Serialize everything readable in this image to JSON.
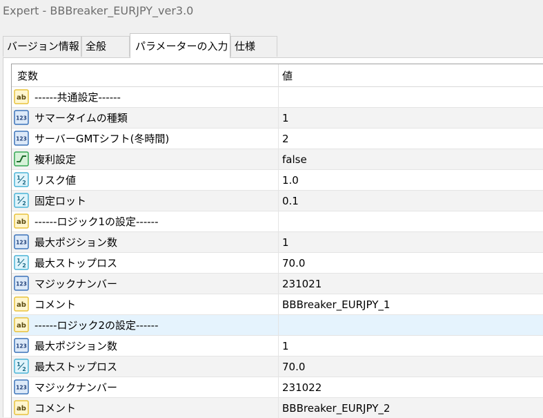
{
  "window": {
    "title": "Expert - BBBreaker_EURJPY_ver3.0"
  },
  "tabs": [
    {
      "label": "バージョン情報",
      "active": false
    },
    {
      "label": "全般",
      "active": false
    },
    {
      "label": "パラメーターの入力",
      "active": true
    },
    {
      "label": "仕様",
      "active": false
    }
  ],
  "table": {
    "headers": {
      "variable": "変数",
      "value": "値"
    },
    "rows": [
      {
        "type": "string",
        "icon": "ab-string-icon",
        "name": "------共通設定------",
        "value": ""
      },
      {
        "type": "int",
        "icon": "123-integer-icon",
        "name": "サマータイムの種類",
        "value": "1"
      },
      {
        "type": "int",
        "icon": "123-integer-icon",
        "name": "サーバーGMTシフト(冬時間)",
        "value": "2"
      },
      {
        "type": "bool",
        "icon": "bool-toggle-icon",
        "name": "複利設定",
        "value": "false"
      },
      {
        "type": "double",
        "icon": "half-double-icon",
        "name": "リスク値",
        "value": "1.0"
      },
      {
        "type": "double",
        "icon": "half-double-icon",
        "name": "固定ロット",
        "value": "0.1"
      },
      {
        "type": "string",
        "icon": "ab-string-icon",
        "name": "------ロジック1の設定------",
        "value": ""
      },
      {
        "type": "int",
        "icon": "123-integer-icon",
        "name": "最大ポジション数",
        "value": "1"
      },
      {
        "type": "double",
        "icon": "half-double-icon",
        "name": "最大ストップロス",
        "value": "70.0"
      },
      {
        "type": "int",
        "icon": "123-integer-icon",
        "name": "マジックナンバー",
        "value": "231021"
      },
      {
        "type": "string",
        "icon": "ab-string-icon",
        "name": "コメント",
        "value": "BBBreaker_EURJPY_1"
      },
      {
        "type": "string",
        "icon": "ab-string-icon",
        "name": "------ロジック2の設定------",
        "value": "",
        "selected": true
      },
      {
        "type": "int",
        "icon": "123-integer-icon",
        "name": "最大ポジション数",
        "value": "1"
      },
      {
        "type": "double",
        "icon": "half-double-icon",
        "name": "最大ストップロス",
        "value": "70.0"
      },
      {
        "type": "int",
        "icon": "123-integer-icon",
        "name": "マジックナンバー",
        "value": "231022"
      },
      {
        "type": "string",
        "icon": "ab-string-icon",
        "name": "コメント",
        "value": "BBBreaker_EURJPY_2"
      }
    ]
  },
  "colors": {
    "selected_row": "#e5f3fd",
    "alt_row": "#f3f3f3",
    "string_icon": "#e8c23a",
    "int_icon": "#3b73b9",
    "double_icon": "#4ab3d6",
    "bool_icon": "#34a853"
  }
}
